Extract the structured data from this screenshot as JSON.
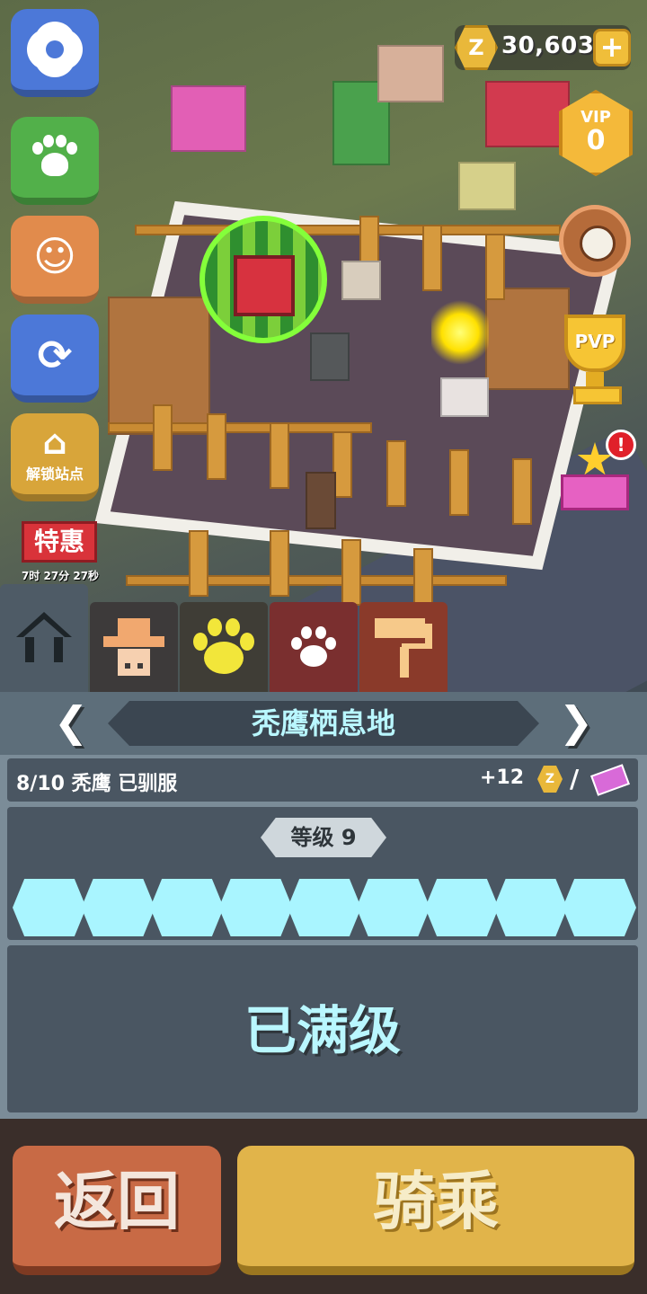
{
  "hud": {
    "coins": "30,603",
    "coin_symbol": "Z",
    "plus_label": "+",
    "vip_label": "VIP",
    "vip_level": "0",
    "pvp_label": "PVP",
    "alert_mark": "!"
  },
  "sidebar": {
    "unlock_label": "解锁站点",
    "sale_label": "特惠",
    "sale_timer": "7时 27分 27秒"
  },
  "tabs": [
    "home",
    "keeper",
    "animal",
    "paw",
    "decor"
  ],
  "panel": {
    "title": "秃鹰栖息地",
    "tamed_info": "8/10 秃鹰 已驯服",
    "reward": "+12",
    "reward_coin": "Z",
    "separator": "/",
    "level_label": "等级 9",
    "level_progress_filled": 9,
    "level_progress_total": 9,
    "status": "已满级"
  },
  "actions": {
    "back_label": "返回",
    "ride_label": "骑乘"
  },
  "colors": {
    "accent_cyan": "#a9f5ff",
    "back_button": "#c86a45",
    "ride_button": "#e1b44a"
  }
}
